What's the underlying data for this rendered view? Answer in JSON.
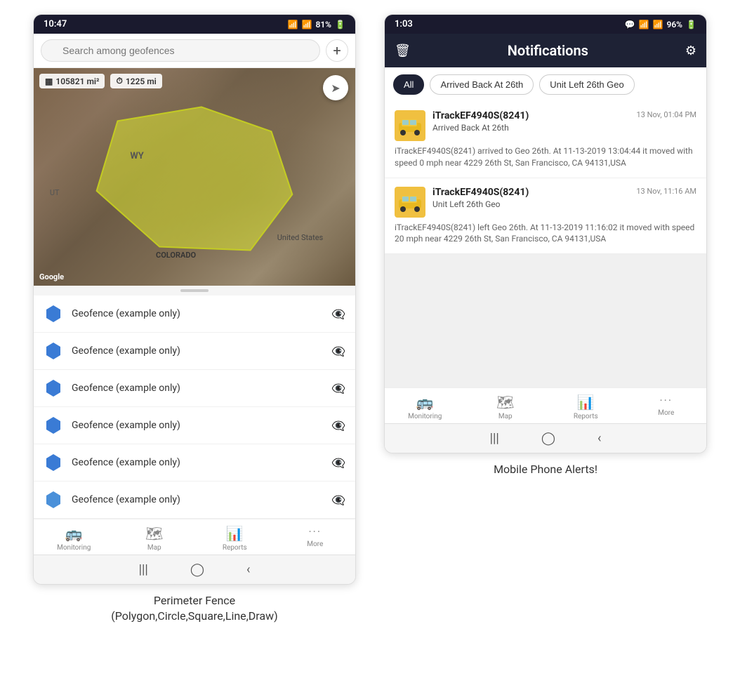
{
  "left_phone": {
    "status_bar": {
      "time": "10:47",
      "signal": "WiFi",
      "battery": "81%"
    },
    "search": {
      "placeholder": "Search among geofences"
    },
    "map": {
      "stat1_label": "105821 mi²",
      "stat2_label": "1225 mi",
      "label_wy": "WY",
      "label_us": "United States",
      "label_co": "COLORADO",
      "label_ut": "UT",
      "google_label": "Google"
    },
    "geofences": [
      {
        "name": "Geofence (example only)"
      },
      {
        "name": "Geofence (example only)"
      },
      {
        "name": "Geofence (example only)"
      },
      {
        "name": "Geofence (example only)"
      },
      {
        "name": "Geofence (example only)"
      },
      {
        "name": "Geofence (example only)"
      }
    ],
    "bottom_nav": [
      {
        "label": "Monitoring",
        "icon": "🚌"
      },
      {
        "label": "Map",
        "icon": "🗺"
      },
      {
        "label": "Reports",
        "icon": "📊"
      },
      {
        "label": "More",
        "icon": "···"
      }
    ]
  },
  "right_phone": {
    "status_bar": {
      "time": "1:03",
      "battery": "96%"
    },
    "header": {
      "title": "Notifications"
    },
    "filters": [
      {
        "label": "All",
        "active": true
      },
      {
        "label": "Arrived Back At 26th",
        "active": false
      },
      {
        "label": "Unit Left 26th Geo",
        "active": false
      }
    ],
    "notifications": [
      {
        "device": "iTrackEF4940S(8241)",
        "timestamp": "13 Nov, 01:04 PM",
        "event_type": "Arrived Back At 26th",
        "description": "iTrackEF4940S(8241) arrived to Geo 26th.    At 11-13-2019 13:04:44 it moved with speed 0 mph near 4229 26th St, San Francisco, CA 94131,USA"
      },
      {
        "device": "iTrackEF4940S(8241)",
        "timestamp": "13 Nov, 11:16 AM",
        "event_type": "Unit Left 26th Geo",
        "description": "iTrackEF4940S(8241) left Geo 26th.   At 11-13-2019 11:16:02 it moved with speed 20 mph near 4229 26th St, San Francisco, CA 94131,USA"
      }
    ],
    "bottom_nav": [
      {
        "label": "Monitoring",
        "icon": "🚌"
      },
      {
        "label": "Map",
        "icon": "🗺"
      },
      {
        "label": "Reports",
        "icon": "📊"
      },
      {
        "label": "More",
        "icon": "···"
      }
    ]
  },
  "captions": {
    "left": "Perimeter Fence\n(Polygon,Circle,Square,Line,Draw)",
    "right": "Mobile Phone Alerts!"
  }
}
